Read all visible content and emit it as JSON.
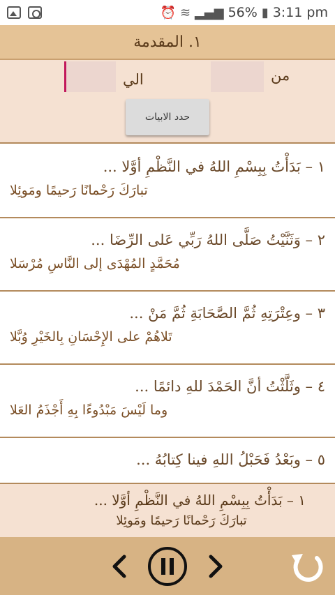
{
  "status": {
    "battery_percent": "56%",
    "time": "3:11 pm"
  },
  "header": {
    "title": "١. المقدمة"
  },
  "range": {
    "from_label": "من",
    "to_label": "الي",
    "set_button": "حدد الابيات"
  },
  "verses": [
    {
      "line1": "١ – بَدَأْتُ بِبِسْمِ اللهُ في النَّظْمِ أوَّلا ...",
      "line2": "تبارَكَ رَحْمانًا رَحيمًا ومَوئِلا"
    },
    {
      "line1": "٢ – وَثَنَّيْتُ صَلَّى اللهُ رَبِّي عَلى الرِّضَا ...",
      "line2": "مُحَمَّدٍ المُهْدَى إلى النَّاسِ مُرْسَلا"
    },
    {
      "line1": "٣ – وعِتْرَتِهِ ثُمَّ الصَّحَابَةِ ثُمَّ مَنْ ...",
      "line2": "تَلاهُمْ على الإِحْسَانِ بِالخَيْرِ وُبَّلا"
    },
    {
      "line1": "٤ – وثَلَّثْتُ أنَّ الحَمْدَ للهِ دائمًا ...",
      "line2": "وما لَيْسَ مَبْدُوءًا بِهِ أَجْذَمُ العَلا"
    },
    {
      "line1": "٥ – وبَعْدُ فَحَبْلُ اللهِ فينا كِتابُهُ ...",
      "line2": ""
    }
  ],
  "player": {
    "line1": "١ – بَدَأْتُ بِبِسْمِ اللهُ في النَّظْمِ أوَّلا ...",
    "line2": "تبارَكَ رَحْمانًا رَحيمًا ومَوئِلا"
  },
  "colors": {
    "header_bg": "#e5c396",
    "range_bg": "#f5e1d2",
    "controls_bg": "#d7b384",
    "text_brown": "#6b4a2b",
    "field_accent": "#c2185b"
  },
  "icons": {
    "prev": "chevron-left-icon",
    "pause": "pause-icon",
    "next": "chevron-right-icon",
    "replay": "replay-icon"
  }
}
